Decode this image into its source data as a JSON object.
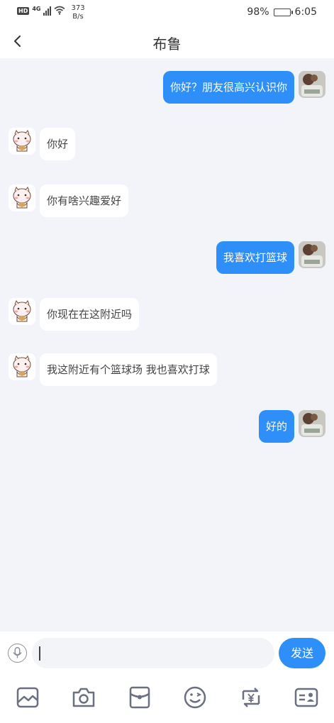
{
  "status_bar": {
    "hd": "HD",
    "network": "4G",
    "speed_value": "373",
    "speed_unit": "B/s",
    "battery_text": "98%",
    "battery_level": 0.98,
    "time": "6:05"
  },
  "header": {
    "title": "布鲁"
  },
  "messages": [
    {
      "from": "me",
      "text": "你好？朋友很高兴认识你"
    },
    {
      "from": "other",
      "text": "你好"
    },
    {
      "from": "other",
      "text": "你有啥兴趣爱好"
    },
    {
      "from": "me",
      "text": "我喜欢打篮球"
    },
    {
      "from": "other",
      "text": "你现在在这附近吗"
    },
    {
      "from": "other",
      "text": "我这附近有个篮球场 我也喜欢打球"
    },
    {
      "from": "me",
      "text": "好的"
    }
  ],
  "composer": {
    "input_value": "",
    "send_label": "发送"
  },
  "toolbar": {
    "icons": [
      "image-icon",
      "camera-icon",
      "red-packet-icon",
      "emoji-icon",
      "transfer-icon",
      "contact-card-icon"
    ]
  },
  "colors": {
    "accent": "#2f8ff8",
    "background": "#f3f4f9"
  }
}
